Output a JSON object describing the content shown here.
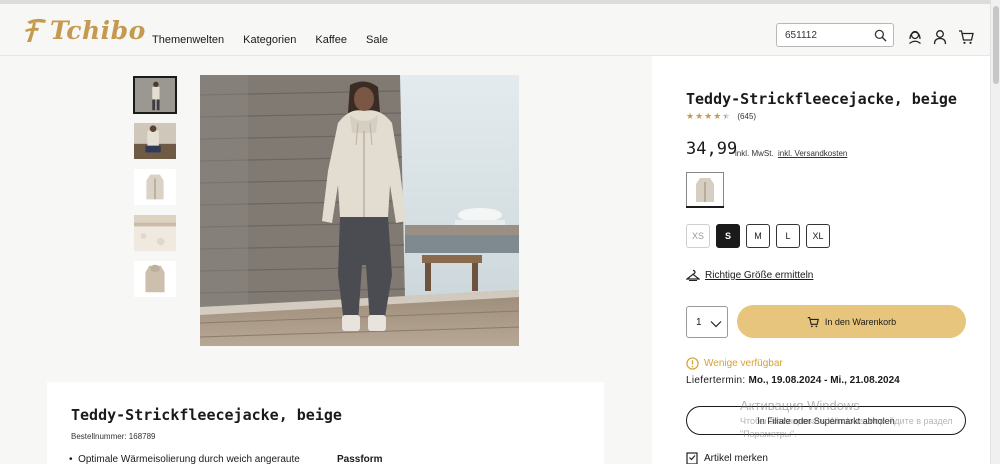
{
  "header": {
    "logo_text": "Tchibo",
    "nav": [
      "Themenwelten",
      "Kategorien",
      "Kaffee",
      "Sale"
    ],
    "search_value": "651112",
    "icons": [
      "search-icon",
      "account-service-icon",
      "user-icon",
      "cart-icon"
    ]
  },
  "gallery": {
    "thumbnails": [
      "model-front",
      "model-sitting",
      "product-front",
      "fabric-detail",
      "product-back"
    ],
    "active_index": 0
  },
  "product": {
    "title": "Teddy-Strickfleecejacke, beige",
    "rating": 4.5,
    "review_count": "(645)",
    "price": "34,99",
    "price_note": "inkl. MwSt.",
    "shipping_link": "inkl. Versandkosten",
    "color_selected": "beige",
    "sizes": [
      {
        "label": "XS",
        "state": "disabled"
      },
      {
        "label": "S",
        "state": "selected"
      },
      {
        "label": "M",
        "state": "available"
      },
      {
        "label": "L",
        "state": "available"
      },
      {
        "label": "XL",
        "state": "available"
      }
    ],
    "size_finder": "Richtige Größe ermitteln",
    "quantity": "1",
    "add_to_cart": "In den Warenkorb",
    "availability": "Wenige verfügbar",
    "delivery_label": "Liefertermin:",
    "delivery_dates": "Mo., 19.08.2024 - Mi., 21.08.2024",
    "store_pickup": "In Filiale oder Supermarkt abholen",
    "wishlist": "Artikel merken"
  },
  "description": {
    "title": "Teddy-Strickfleecejacke, beige",
    "order_number": "Bestellnummer: 168789",
    "bullet_1": "Optimale Wärmeisolierung durch weich angeraute",
    "passform_heading": "Passform"
  },
  "watermark": {
    "title": "Активация Windows",
    "line_1": "Чтобы активировать Windows, перейдите в раздел",
    "line_2": "\"Параметры\"."
  },
  "colors": {
    "accent_gold": "#c69a4e",
    "cart_button": "#e8c57c",
    "availability": "#d4a233",
    "text": "#1a1a1a"
  }
}
